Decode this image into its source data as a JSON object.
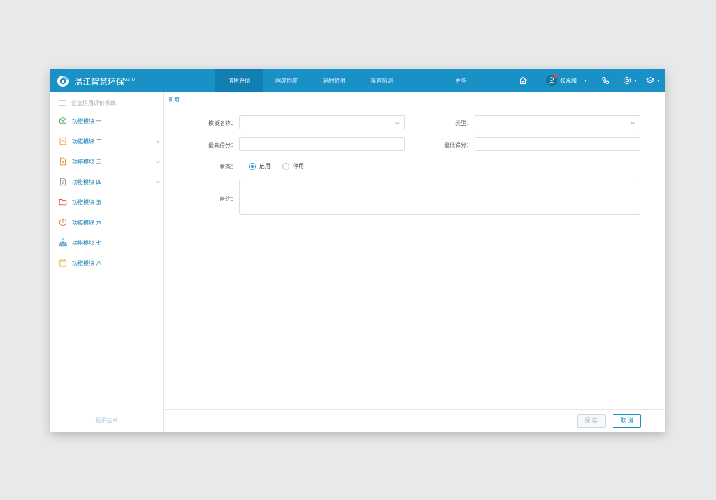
{
  "header": {
    "app_title": "温江智慧环保",
    "app_version": "V3.0",
    "nav_tabs": [
      {
        "label": "信用评价",
        "active": true
      },
      {
        "label": "固废危废",
        "active": false
      },
      {
        "label": "辐射放射",
        "active": false
      },
      {
        "label": "噪声监测",
        "active": false
      }
    ],
    "nav_more": "更多",
    "user_name": "张永和",
    "icons": [
      "home-icon",
      "user-avatar-icon",
      "phone-icon",
      "settings-icon",
      "layers-icon"
    ],
    "colors": {
      "bar": "#1a91c6",
      "active_tab": "#127fb3"
    }
  },
  "sidebar": {
    "title": "企业信用评价系统",
    "items": [
      {
        "label": "功能模块 一",
        "icon": "cube-icon",
        "color": "#3aa655",
        "expandable": false
      },
      {
        "label": "功能模块 二",
        "icon": "document-check-icon",
        "color": "#e0a020",
        "expandable": true
      },
      {
        "label": "功能模块 三",
        "icon": "document-icon",
        "color": "#f08a24",
        "expandable": true
      },
      {
        "label": "功能模块 四",
        "icon": "file-text-icon",
        "color": "#8a8f99",
        "expandable": true
      },
      {
        "label": "功能模块 五",
        "icon": "folder-icon",
        "color": "#e0504a",
        "expandable": false
      },
      {
        "label": "功能模块 六",
        "icon": "clock-icon",
        "color": "#f06a3a",
        "expandable": false
      },
      {
        "label": "功能模块 七",
        "icon": "org-chart-icon",
        "color": "#2a7cb0",
        "expandable": false
      },
      {
        "label": "功能模块 八",
        "icon": "clipboard-icon",
        "color": "#e0a020",
        "expandable": false
      }
    ],
    "footer": "扬讯技术"
  },
  "main": {
    "tab_label": "新增",
    "form": {
      "template_name_label": "模板名称：",
      "template_name_value": "",
      "type_label": "类型：",
      "type_value": "",
      "max_score_label": "最高得分：",
      "max_score_value": "",
      "min_score_label": "最低得分：",
      "min_score_value": "",
      "status_label": "状态：",
      "status_options": [
        {
          "label": "启用",
          "checked": true
        },
        {
          "label": "停用",
          "checked": false
        }
      ],
      "remark_label": "备注：",
      "remark_value": ""
    },
    "buttons": {
      "save": "保 存",
      "cancel": "取 消"
    }
  }
}
